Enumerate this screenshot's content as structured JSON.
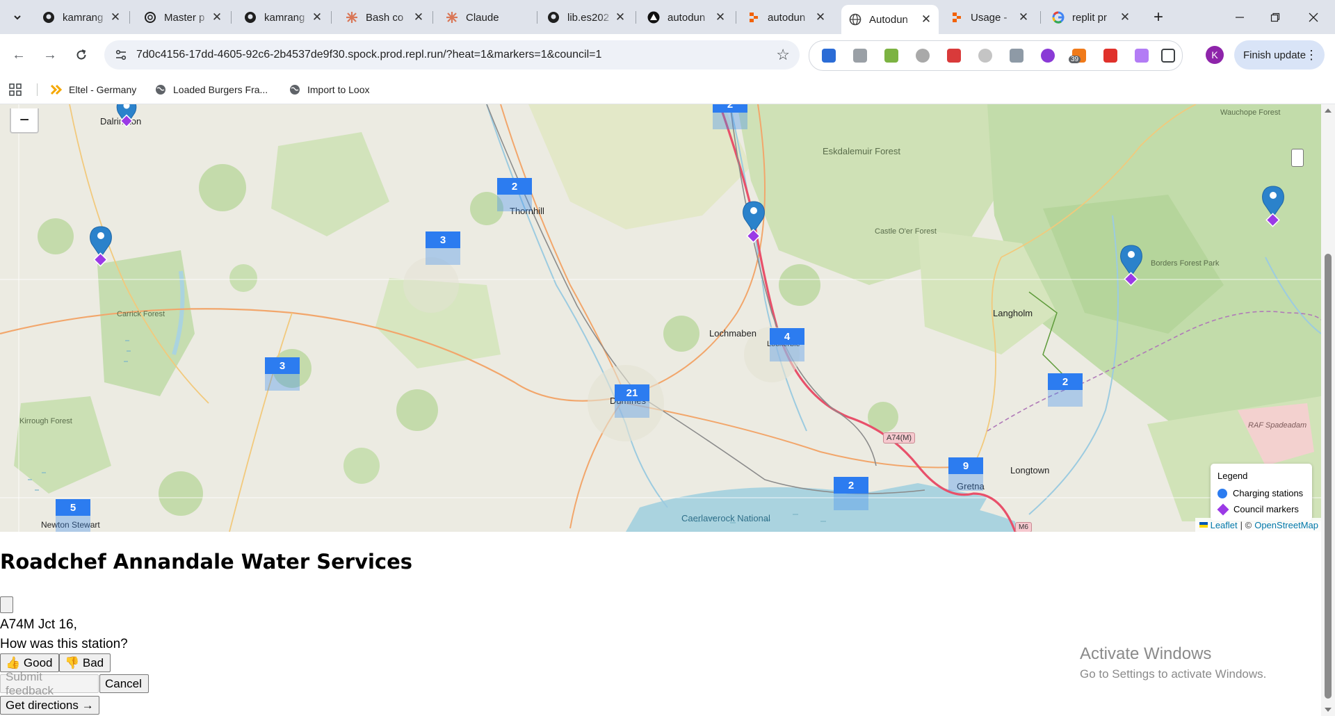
{
  "tabs": [
    {
      "title": "kamrang",
      "icon": "github-icon"
    },
    {
      "title": "Master p",
      "icon": "openai-icon"
    },
    {
      "title": "kamrang",
      "icon": "github-icon"
    },
    {
      "title": "Bash co",
      "icon": "claude-icon"
    },
    {
      "title": "Claude",
      "icon": "claude-icon"
    },
    {
      "title": "lib.es202",
      "icon": "github-icon"
    },
    {
      "title": "autodun",
      "icon": "vercel-icon"
    },
    {
      "title": "autodun",
      "icon": "replit-icon"
    },
    {
      "title": "Autodun",
      "icon": "globe-icon",
      "active": true
    },
    {
      "title": "Usage -",
      "icon": "replit-icon"
    },
    {
      "title": "replit pr",
      "icon": "google-icon"
    }
  ],
  "toolbar": {
    "url": "7d0c4156-17dd-4605-92c6-2b4537de9f30.spock.prod.repl.run/?heat=1&markers=1&council=1",
    "extension_badge": "39",
    "profile_initial": "K",
    "finish_update_label": "Finish update"
  },
  "bookmarks": [
    {
      "label": "Eltel - Germany",
      "icon": "eltel-icon"
    },
    {
      "label": "Loaded Burgers Fra...",
      "icon": "globe-icon"
    },
    {
      "label": "Import to Loox",
      "icon": "globe-icon"
    }
  ],
  "map": {
    "zoom_out_label": "−",
    "clusters": [
      "2",
      "2",
      "3",
      "3",
      "21",
      "4",
      "2",
      "9",
      "2",
      "5"
    ],
    "places": {
      "darlington": "Dalrington",
      "thornhill": "Thornhill",
      "eskdalemuir": "Eskdalemuir Forest",
      "wauchope": "Wauchope Forest",
      "castle_oer": "Castle O'er Forest",
      "borders": "Borders Forest Park",
      "langholm": "Langholm",
      "lochmaben": "Lochmaben",
      "lockerbie": "Lockerbie",
      "carrick": "Carrick Forest",
      "kirroughtree": "Kirrough Forest",
      "dumfries": "Dumfries",
      "gretna": "Gretna",
      "longtown": "Longtown",
      "raf": "RAF Spadeadam",
      "newton_stewart": "Newton Stewart",
      "caerlaverock": "Caerlaverock National"
    },
    "road_badges": {
      "a74m": "A74(M)",
      "m6": "M6"
    },
    "legend": {
      "title": "Legend",
      "items": [
        {
          "label": "Charging stations",
          "color": "#2c7cf0"
        },
        {
          "label": "Council markers",
          "color": "#9b3ae6"
        }
      ]
    },
    "attribution": {
      "leaflet": "Leaflet",
      "separator": "| ©",
      "osm": "OpenStreetMap"
    }
  },
  "station": {
    "name": "Roadchef Annandale Water Services",
    "address": "A74M Jct 16,",
    "question": "How was this station?",
    "good_label": "👍 Good",
    "bad_label": "👎 Bad",
    "submit_label": "Submit feedback",
    "cancel_label": "Cancel",
    "directions_label": "Get directions →"
  },
  "watermark": {
    "title": "Activate Windows",
    "subtitle": "Go to Settings to activate Windows."
  }
}
